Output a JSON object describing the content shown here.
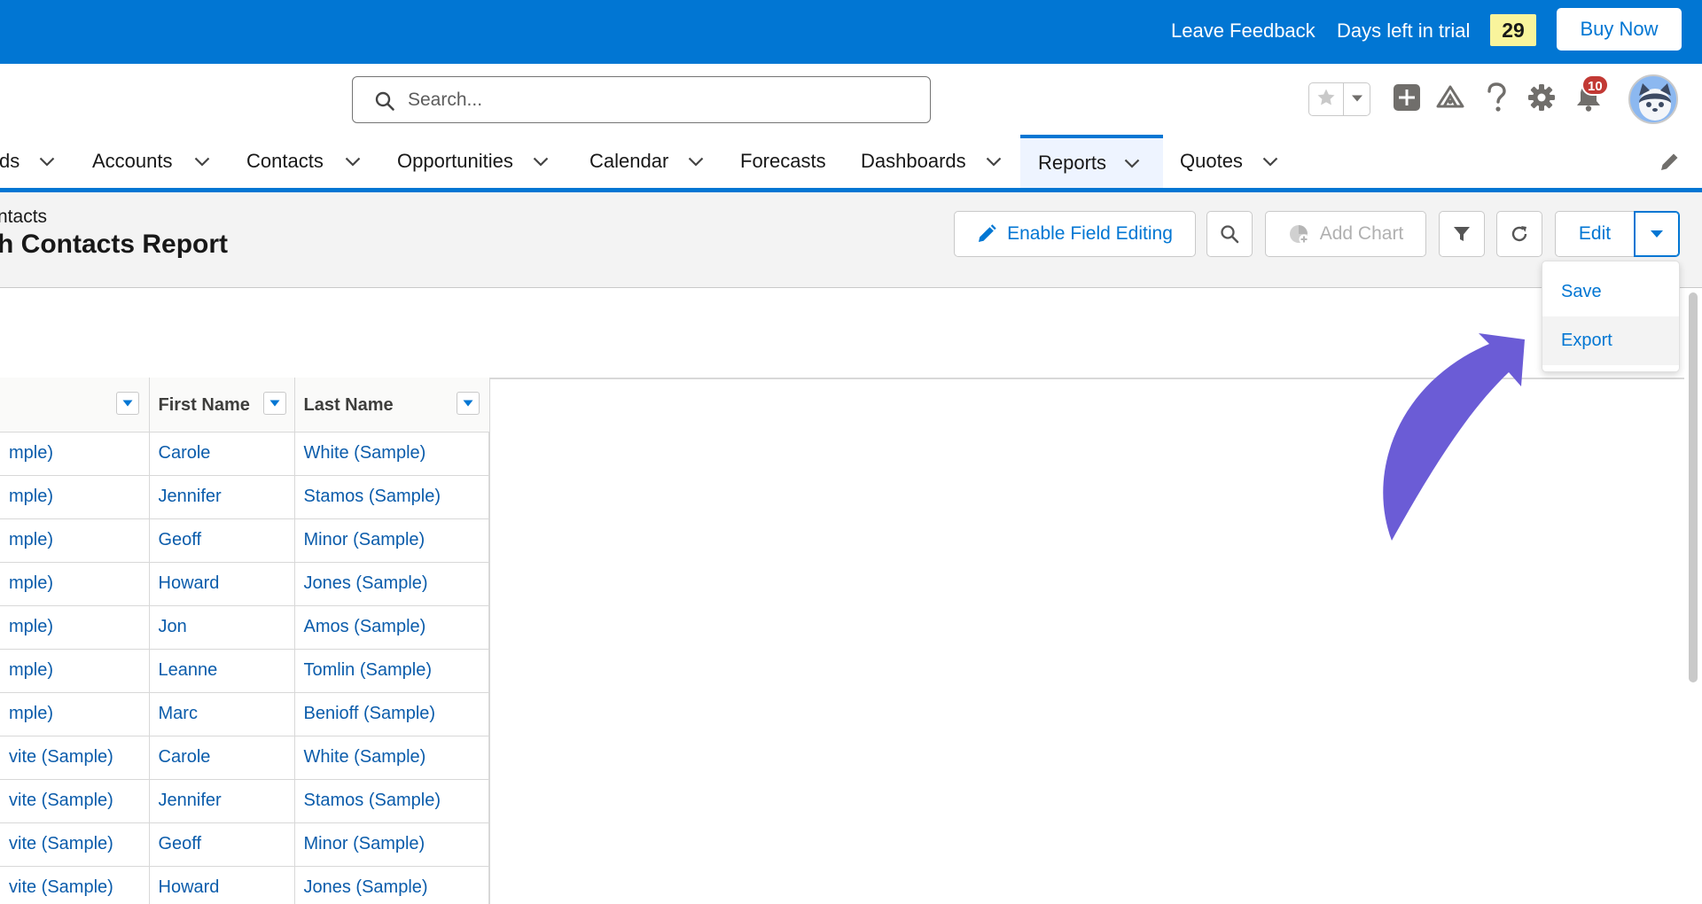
{
  "trial_bar": {
    "leave_feedback": "Leave Feedback",
    "days_left_label": "Days left in trial",
    "days_left_value": "29",
    "buy_now": "Buy Now"
  },
  "header": {
    "search_placeholder": "Search...",
    "notification_count": "10",
    "icons": [
      "star-icon",
      "chevron-down-icon",
      "add-icon",
      "trailhead-icon",
      "help-icon",
      "gear-icon",
      "bell-icon",
      "avatar"
    ]
  },
  "nav": {
    "items": [
      {
        "label": "ds",
        "has_menu": true
      },
      {
        "label": "Accounts",
        "has_menu": true
      },
      {
        "label": "Contacts",
        "has_menu": true
      },
      {
        "label": "Opportunities",
        "has_menu": true
      },
      {
        "label": "Calendar",
        "has_menu": true
      },
      {
        "label": "Forecasts",
        "has_menu": false
      },
      {
        "label": "Dashboards",
        "has_menu": true
      },
      {
        "label": "Reports",
        "has_menu": true,
        "active": true
      },
      {
        "label": "Quotes",
        "has_menu": true
      }
    ]
  },
  "page_header": {
    "object_label": "ntacts",
    "title": "h Contacts Report",
    "buttons": {
      "enable_field_editing": "Enable Field Editing",
      "add_chart": "Add Chart",
      "edit": "Edit"
    }
  },
  "dropdown_menu": {
    "items": [
      "Save",
      "Export"
    ]
  },
  "table": {
    "columns": [
      "",
      "First Name",
      "Last Name"
    ],
    "rows": [
      [
        "mple)",
        "Carole",
        "White (Sample)"
      ],
      [
        "mple)",
        "Jennifer",
        "Stamos (Sample)"
      ],
      [
        "mple)",
        "Geoff",
        "Minor (Sample)"
      ],
      [
        "mple)",
        "Howard",
        "Jones (Sample)"
      ],
      [
        "mple)",
        "Jon",
        "Amos (Sample)"
      ],
      [
        "mple)",
        "Leanne",
        "Tomlin (Sample)"
      ],
      [
        "mple)",
        "Marc",
        "Benioff (Sample)"
      ],
      [
        "vite (Sample)",
        "Carole",
        "White (Sample)"
      ],
      [
        "vite (Sample)",
        "Jennifer",
        "Stamos (Sample)"
      ],
      [
        "vite (Sample)",
        "Geoff",
        "Minor (Sample)"
      ],
      [
        "vite (Sample)",
        "Howard",
        "Jones (Sample)"
      ]
    ]
  },
  "colors": {
    "brand_blue": "#0176d3",
    "trial_badge": "#f9f49c",
    "link_blue": "#0b5cab",
    "annotation_arrow": "#6b5cd6",
    "notification_red": "#c23934"
  }
}
